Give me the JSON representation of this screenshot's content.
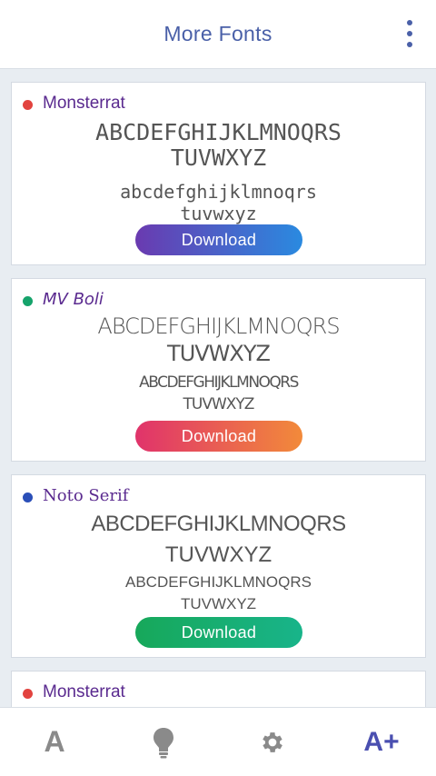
{
  "header": {
    "title": "More Fonts",
    "menu_icon": "more-vert-icon"
  },
  "cards": [
    {
      "name": "Monsterrat",
      "dot_color": "#e2433f",
      "upper_line1": "ABCDEFGHIJKLMNOQRS",
      "upper_line2": "TUVWXYZ",
      "lower_line1": "abcdefghijklmnoqrs",
      "lower_line2": "tuvwxyz",
      "button_label": "Download",
      "button_gradient": [
        "#6a3ab0",
        "#2a8ae0"
      ]
    },
    {
      "name": "MV Boli",
      "dot_color": "#16a36b",
      "upper_line1": "ABCDEFGHIJKLMNOQRS",
      "upper_line2": "TUVWXYZ",
      "lower_line1": "ABCDEFGHIJKLMNOQRS",
      "lower_line2": "TUVWXYZ",
      "button_label": "Download",
      "button_gradient": [
        "#e0336b",
        "#f28a3a"
      ]
    },
    {
      "name": "Noto Serif",
      "dot_color": "#2b4fb8",
      "upper_line1": "ABCDEFGHIJKLMNOQRS",
      "upper_line2": "TUVWXYZ",
      "lower_line1": "ABCDEFGHIJKLMNOQRS",
      "lower_line2": "TUVWXYZ",
      "button_label": "Download",
      "button_gradient": [
        "#17a85a",
        "#18b48a"
      ]
    },
    {
      "name": "Monsterrat",
      "dot_color": "#e2433f"
    }
  ],
  "nav": {
    "items": [
      {
        "icon": "font-a-icon",
        "glyph": "A"
      },
      {
        "icon": "lightbulb-icon"
      },
      {
        "icon": "gear-icon"
      },
      {
        "icon": "font-add-icon",
        "glyph": "A+",
        "active": true
      }
    ]
  }
}
